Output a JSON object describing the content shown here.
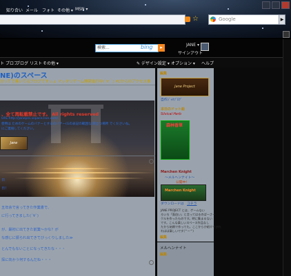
{
  "browser": {
    "address_value": "",
    "google_search_placeholder": "Google",
    "search_button_label": "▶"
  },
  "nav": {
    "items": [
      "知り合い",
      "メール",
      "フォト",
      "その他 ▾",
      "MSN ▾"
    ],
    "search_placeholder": "検索...",
    "bing_label": "bing",
    "user_name": "JANE ▾",
    "signout_label": "サインアウト"
  },
  "subnav": {
    "items": [
      "ト",
      "プロフ",
      "ブログ",
      "リスト",
      "その他 ▾"
    ],
    "right_items": [
      "✎ デザイン設定 ▾",
      "オプション ▾",
      "ヘルプ"
    ]
  },
  "page": {
    "title": "NE)のスペース",
    "tagline": "分ってで書いてるブログですぃょ マッタリゲーム開発進行中(´∀｀)  PCからのアクセス推"
  },
  "header": {
    "warning": "、全て再転載禁止です。 All rights reserved",
    "url_line": "URL:http://janepro.vspace.live.com/",
    "lines": [
      "使用は ためのゲームのバナーとするのバナー(Gの表記の範囲な)目立つ場所 でくださいね。",
      "にご連絡してください。"
    ],
    "banner_label": "Jane"
  },
  "body_lines": [
    "日",
    "日！",
    "",
    "五年余で言ってきた作業書で、",
    "に行ってきました(´∀`)",
    "",
    "が、最初に出てきた前業～かな？が",
    "な感じに振られ出てきてびっくりしました≫",
    "",
    "とんでもないことになってきたな・・・",
    "",
    "探に向かう何するんだね・・・"
  ],
  "sidebar": {
    "edit1": "編集",
    "jane_logo": "Jane Project",
    "jane_caption": "自作ｼﾞｬﾈﾌﾞﾛｸﾞ",
    "dotgame_heading": "本日のドット絵",
    "sylvical_label": "Silvical Herb",
    "sylvical_title": "森林香草",
    "march_heading": "Marchen Knight",
    "march_subheading": "～メルヘンナイト～",
    "march_status": "公開中！",
    "march_banner": "Marchen Knight",
    "download_label": "ダウンロードは",
    "download_link": "コチラ",
    "about_lines": [
      "JANE PROJECT とは、ゲームない",
      "ろいろ「面白い」と言ってはるのぱーさー",
      "クルを作ったものです。時に集まるない",
      "です。こんな楽しいスペース作品なし",
      "たから始期で作ってた。ここからか紹介できれ",
      "ればば楽しいです(^ー^)"
    ],
    "edit2": "編集",
    "melhen_heading": "メルヘンナイト",
    "edit3": "編集"
  }
}
